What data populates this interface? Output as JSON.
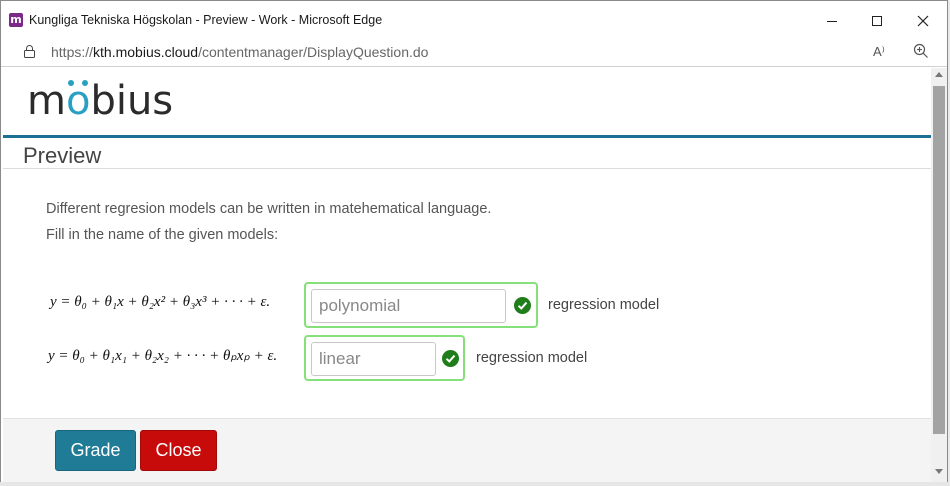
{
  "window": {
    "title": "Kungliga Tekniska Högskolan - Preview - Work - Microsoft Edge",
    "app_icon_letter": "m",
    "icon_color": "#7b2a8a"
  },
  "addressbar": {
    "url_scheme": "https://",
    "url_host": "kth.mobius.cloud",
    "url_path": "/contentmanager/DisplayQuestion.do",
    "read_aloud_label": "A⁾"
  },
  "page": {
    "logo_parts": [
      "m",
      "o",
      "bius"
    ],
    "heading": "Preview",
    "instructions": [
      "Different regresion models can be written in matehematical language.",
      "Fill in the name of the given models:"
    ],
    "questions": [
      {
        "equation": "y = θ₀ + θ₁x + θ₂x² + θ₃x³ + · · · + ε.",
        "answer": "polynomial",
        "status": "correct",
        "suffix": "regression model"
      },
      {
        "equation": "y = θ₀ + θ₁x₁ + θ₂x₂ + · · · + θₚxₚ + ε.",
        "answer": "linear",
        "status": "correct",
        "suffix": "regression model"
      }
    ],
    "buttons": {
      "grade": "Grade",
      "close": "Close"
    }
  },
  "colors": {
    "accent_blue": "#1f7b96",
    "close_red": "#c70b0b",
    "correct_green": "#1f7d1a",
    "correct_border": "#86e07a",
    "logo_accent": "#2a9fc4"
  }
}
